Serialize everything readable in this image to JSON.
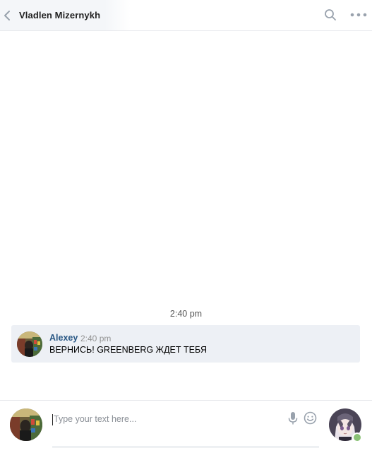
{
  "header": {
    "title": "Vladlen Mizernykh",
    "back_icon": "chevron-left-icon",
    "search_icon": "search-icon",
    "more_icon": "more-horizontal-icon"
  },
  "history": {
    "date_separator": "2:40 pm",
    "messages": [
      {
        "author": "Alexey",
        "time": "2:40 pm",
        "text": "ВЕРНИСЬ! GREENBERG ЖДЕТ ТЕБЯ"
      }
    ]
  },
  "composer": {
    "placeholder": "Type your text here...",
    "value": "",
    "mic_icon": "microphone-icon",
    "emoji_icon": "smile-icon",
    "peer_online": true
  },
  "colors": {
    "accent_link": "#2a5885",
    "message_bg": "#edf0f5",
    "online": "#8ac176",
    "icon": "#99a2ad"
  }
}
